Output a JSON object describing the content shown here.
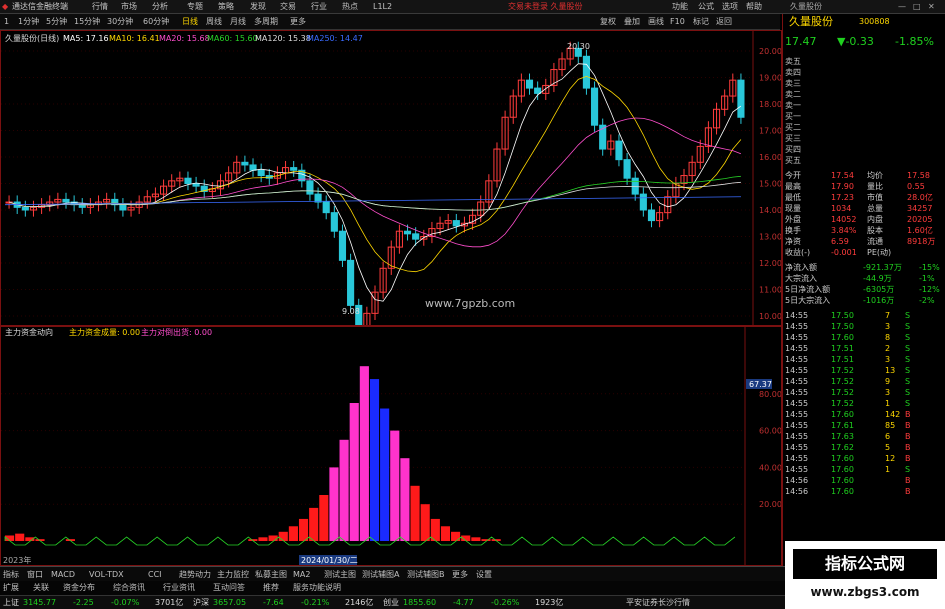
{
  "app": {
    "title": "通达信金融终端",
    "menus": [
      "行情",
      "市场",
      "分析",
      "专题",
      "策略",
      "发现",
      "交易",
      "行业",
      "热点",
      "L1L2"
    ],
    "notice": "交易未登录 久量股份",
    "right_menus": [
      "功能",
      "公式",
      "选项",
      "帮助"
    ],
    "window_title": "久量股份"
  },
  "toolbar": {
    "periods": [
      "1",
      "1分钟",
      "5分钟",
      "15分钟",
      "30分钟",
      "60分钟",
      "日线",
      "周线",
      "月线",
      "多周期",
      "更多"
    ],
    "right_items": [
      "复权",
      "叠加",
      "画线",
      "F10",
      "标记",
      "返回"
    ]
  },
  "main_chart": {
    "stock_label": "久量股份(日线)",
    "ma": [
      {
        "name": "MA5: 17.16",
        "color": "#ffffff"
      },
      {
        "name": "MA10: 16.41",
        "color": "#ffd800"
      },
      {
        "name": "MA20: 15.68",
        "color": "#ff4ecd"
      },
      {
        "name": "MA60: 15.60",
        "color": "#27d327"
      },
      {
        "name": "MA120: 15.38",
        "color": "#ddd"
      },
      {
        "name": "MA250: 14.47",
        "color": "#3a6bff"
      }
    ],
    "y_ticks": [
      "20.00",
      "19.00",
      "18.00",
      "17.00",
      "16.00",
      "15.00",
      "14.00",
      "13.00",
      "12.00",
      "11.00",
      "10.00"
    ],
    "high_label": "20.30",
    "low_label": "9.08",
    "watermark": "www.7gpzb.com"
  },
  "chart_data": {
    "type": "bar",
    "title": "主力资金动向",
    "series": [
      {
        "name": "主力资金动向",
        "values": [
          3,
          4,
          2,
          1,
          0,
          0,
          1,
          0,
          0,
          0,
          0,
          0,
          0,
          0,
          0,
          0,
          0,
          0,
          0,
          0,
          0,
          0,
          0,
          0,
          1,
          2,
          3,
          5,
          8,
          12,
          18,
          25,
          40,
          55,
          75,
          95,
          88,
          72,
          60,
          45,
          30,
          20,
          12,
          8,
          5,
          3,
          2,
          1,
          1,
          0,
          0,
          0,
          0,
          0,
          0,
          0,
          0,
          0,
          0,
          0,
          0,
          0,
          0,
          0,
          0,
          0,
          0,
          0,
          0,
          0,
          0,
          0,
          0
        ]
      }
    ],
    "ylim": [
      0,
      100
    ],
    "y_ticks": [
      "80.00",
      "60.00",
      "40.00",
      "20.00"
    ]
  },
  "sub_chart": {
    "title": "主力资金动向",
    "i1": "主力资金成量: 0.00",
    "i2": "主力对倒出货: 0.00",
    "marker": "67.37",
    "date": "2024/01/30/二",
    "year": "2023年"
  },
  "quote": {
    "name": "久量股份",
    "code": "300808",
    "price": "17.47",
    "change": "▼-0.33",
    "pct": "-1.85%"
  },
  "book": [
    {
      "label": "卖五"
    },
    {
      "label": "卖四"
    },
    {
      "label": "卖三"
    },
    {
      "label": "卖二"
    },
    {
      "label": "卖一"
    },
    {
      "label": "买一"
    },
    {
      "label": "买二"
    },
    {
      "label": "买三"
    },
    {
      "label": "买四"
    },
    {
      "label": "买五"
    }
  ],
  "stats": [
    [
      "今开",
      "17.54",
      "均价",
      "17.58"
    ],
    [
      "最高",
      "17.90",
      "量比",
      "0.55"
    ],
    [
      "最低",
      "17.23",
      "市值",
      "28.0亿"
    ],
    [
      "现量",
      "1034",
      "总量",
      "34257"
    ],
    [
      "外盘",
      "14052",
      "内盘",
      "20205"
    ],
    [
      "换手",
      "3.84%",
      "股本",
      "1.60亿"
    ],
    [
      "净资",
      "6.59",
      "流通",
      "8918万"
    ],
    [
      "收益(-)",
      "-0.001",
      "PE(动)",
      ""
    ]
  ],
  "flows": [
    [
      "净流入额",
      "-921.37万",
      "-15%"
    ],
    [
      "大宗流入",
      "-44.9万",
      "-1%"
    ],
    [
      "5日净流入额",
      "-6305万",
      "-12%"
    ],
    [
      "5日大宗流入",
      "-1016万",
      "-2%"
    ]
  ],
  "ticks": [
    [
      "14:55",
      "17.50",
      "7",
      "S"
    ],
    [
      "14:55",
      "17.50",
      "3",
      "S"
    ],
    [
      "14:55",
      "17.60",
      "8",
      "S"
    ],
    [
      "14:55",
      "17.51",
      "2",
      "S"
    ],
    [
      "14:55",
      "17.51",
      "3",
      "S"
    ],
    [
      "14:55",
      "17.52",
      "13",
      "S"
    ],
    [
      "14:55",
      "17.52",
      "9",
      "S"
    ],
    [
      "14:55",
      "17.52",
      "3",
      "S"
    ],
    [
      "14:55",
      "17.52",
      "1",
      "S"
    ],
    [
      "14:55",
      "17.60",
      "142",
      "B"
    ],
    [
      "14:55",
      "17.61",
      "85",
      "B"
    ],
    [
      "14:55",
      "17.63",
      "6",
      "B"
    ],
    [
      "14:55",
      "17.62",
      "5",
      "B"
    ],
    [
      "14:55",
      "17.60",
      "12",
      "B"
    ],
    [
      "14:55",
      "17.60",
      "1",
      "S"
    ],
    [
      "14:56",
      "17.60",
      "",
      "B"
    ],
    [
      "14:56",
      "17.60",
      "",
      "B"
    ]
  ],
  "indicators": [
    "指标",
    "窗口",
    "MACD",
    "VOL-TDX",
    "CCI",
    "趋势动力",
    "主力监控",
    "私募主图",
    "MA2",
    "测试主图",
    "测试辅图A",
    "测试辅图B",
    "更多",
    "设置"
  ],
  "bottom_tabs": [
    "扩展",
    "关联",
    "资金分布",
    "综合资讯",
    "行业资讯",
    "互动问答",
    "推荐",
    "服务功能说明"
  ],
  "status": [
    [
      "上证",
      "3145.77",
      "-2.25",
      "-0.07%",
      "3701亿"
    ],
    [
      "沪深",
      "3657.05",
      "-7.64",
      "-0.21%",
      "2146亿"
    ],
    [
      "创业",
      "1855.60",
      "-4.77",
      "-0.26%",
      "1923亿"
    ]
  ],
  "status_right": "平安证券长沙行情",
  "site": {
    "brand": "指标公式网",
    "url": "www.zbgs3.com"
  }
}
